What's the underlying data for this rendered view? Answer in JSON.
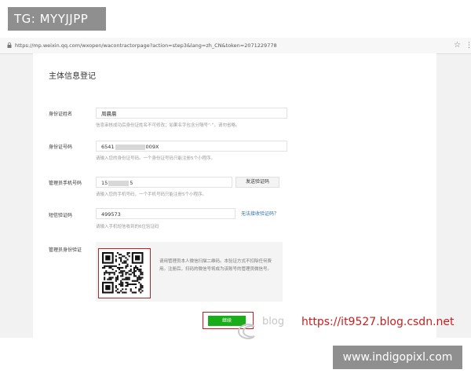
{
  "overlay": {
    "top_left_badge": "TG: MYYJJPP",
    "bottom_right_badge": "www.indigopixl.com",
    "watermark_faint": "blog",
    "watermark_red": "https://it9527.blog.csdn.net"
  },
  "browser": {
    "url": "https://mp.weixin.qq.com/wxopen/wacontractorpage?action=step3&lang=zh_CN&token=2071229778"
  },
  "form": {
    "title": "主体信息登记",
    "fields": [
      {
        "label": "身份证姓名",
        "value": "周晨晨",
        "hint": "信息审核成功后身份证姓名不可修改；如果名字包含分隔号“·”，请勿省略。"
      },
      {
        "label": "身份证号码",
        "value_prefix": "6541",
        "value_suffix": "009X",
        "hint": "请输入您的身份证号码。一个身份证号码只能注册5个小程序。"
      },
      {
        "label": "管理员手机号码",
        "value_prefix": "15",
        "value_suffix": "5",
        "button": "发送验证码",
        "hint": "请输入您的手机号码，一个手机号码只能注册5个小程序。"
      },
      {
        "label": "短信验证码",
        "value": "499573",
        "link": "无法接收验证码？",
        "hint": "请输入手机短信收到的6位验证码"
      }
    ],
    "identity": {
      "label": "管理员身份验证",
      "instructions": "请用管理员本人微信扫描二维码。本验证方式不扣除任何费用。注册后，扫码的微信号将成为该账号的管理员微信号。"
    },
    "submit_label": "继续"
  },
  "colors": {
    "accent_green": "#1aad19",
    "highlight_red": "#c82020",
    "link_blue": "#3070b0"
  },
  "icons": {
    "lock": "lock-icon",
    "star": "star-icon",
    "menu": "more-vertical-icon",
    "qr": "qr-code"
  }
}
